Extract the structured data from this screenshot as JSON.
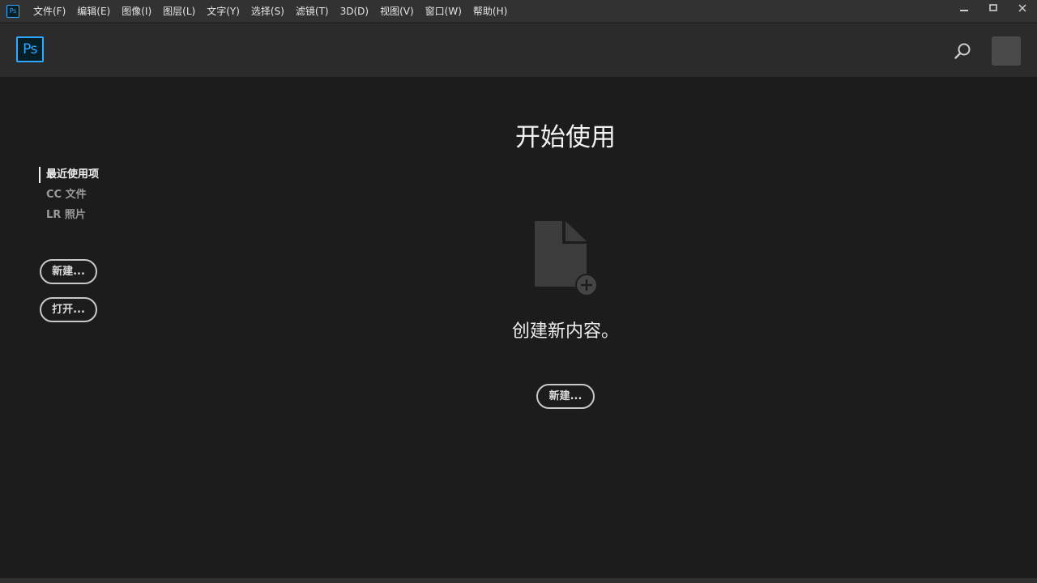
{
  "window": {
    "app_icon_text": "Ps"
  },
  "menu": {
    "items": [
      {
        "label": "文件(F)"
      },
      {
        "label": "编辑(E)"
      },
      {
        "label": "图像(I)"
      },
      {
        "label": "图层(L)"
      },
      {
        "label": "文字(Y)"
      },
      {
        "label": "选择(S)"
      },
      {
        "label": "滤镜(T)"
      },
      {
        "label": "3D(D)"
      },
      {
        "label": "视图(V)"
      },
      {
        "label": "窗口(W)"
      },
      {
        "label": "帮助(H)"
      }
    ]
  },
  "header": {
    "logo_text": "Ps",
    "search_icon": "search-icon",
    "avatar": "avatar"
  },
  "sidebar": {
    "nav": [
      {
        "label": "最近使用项",
        "active": true
      },
      {
        "label": "CC 文件",
        "active": false
      },
      {
        "label": "LR 照片",
        "active": false
      }
    ],
    "new_button": "新建...",
    "open_button": "打开..."
  },
  "main": {
    "title": "开始使用",
    "empty_icon": "new-document-icon",
    "empty_text": "创建新内容。",
    "new_button": "新建..."
  },
  "colors": {
    "accent": "#31a8ff",
    "background": "#1c1c1c",
    "header": "#2b2b2b",
    "menubar": "#323232"
  }
}
